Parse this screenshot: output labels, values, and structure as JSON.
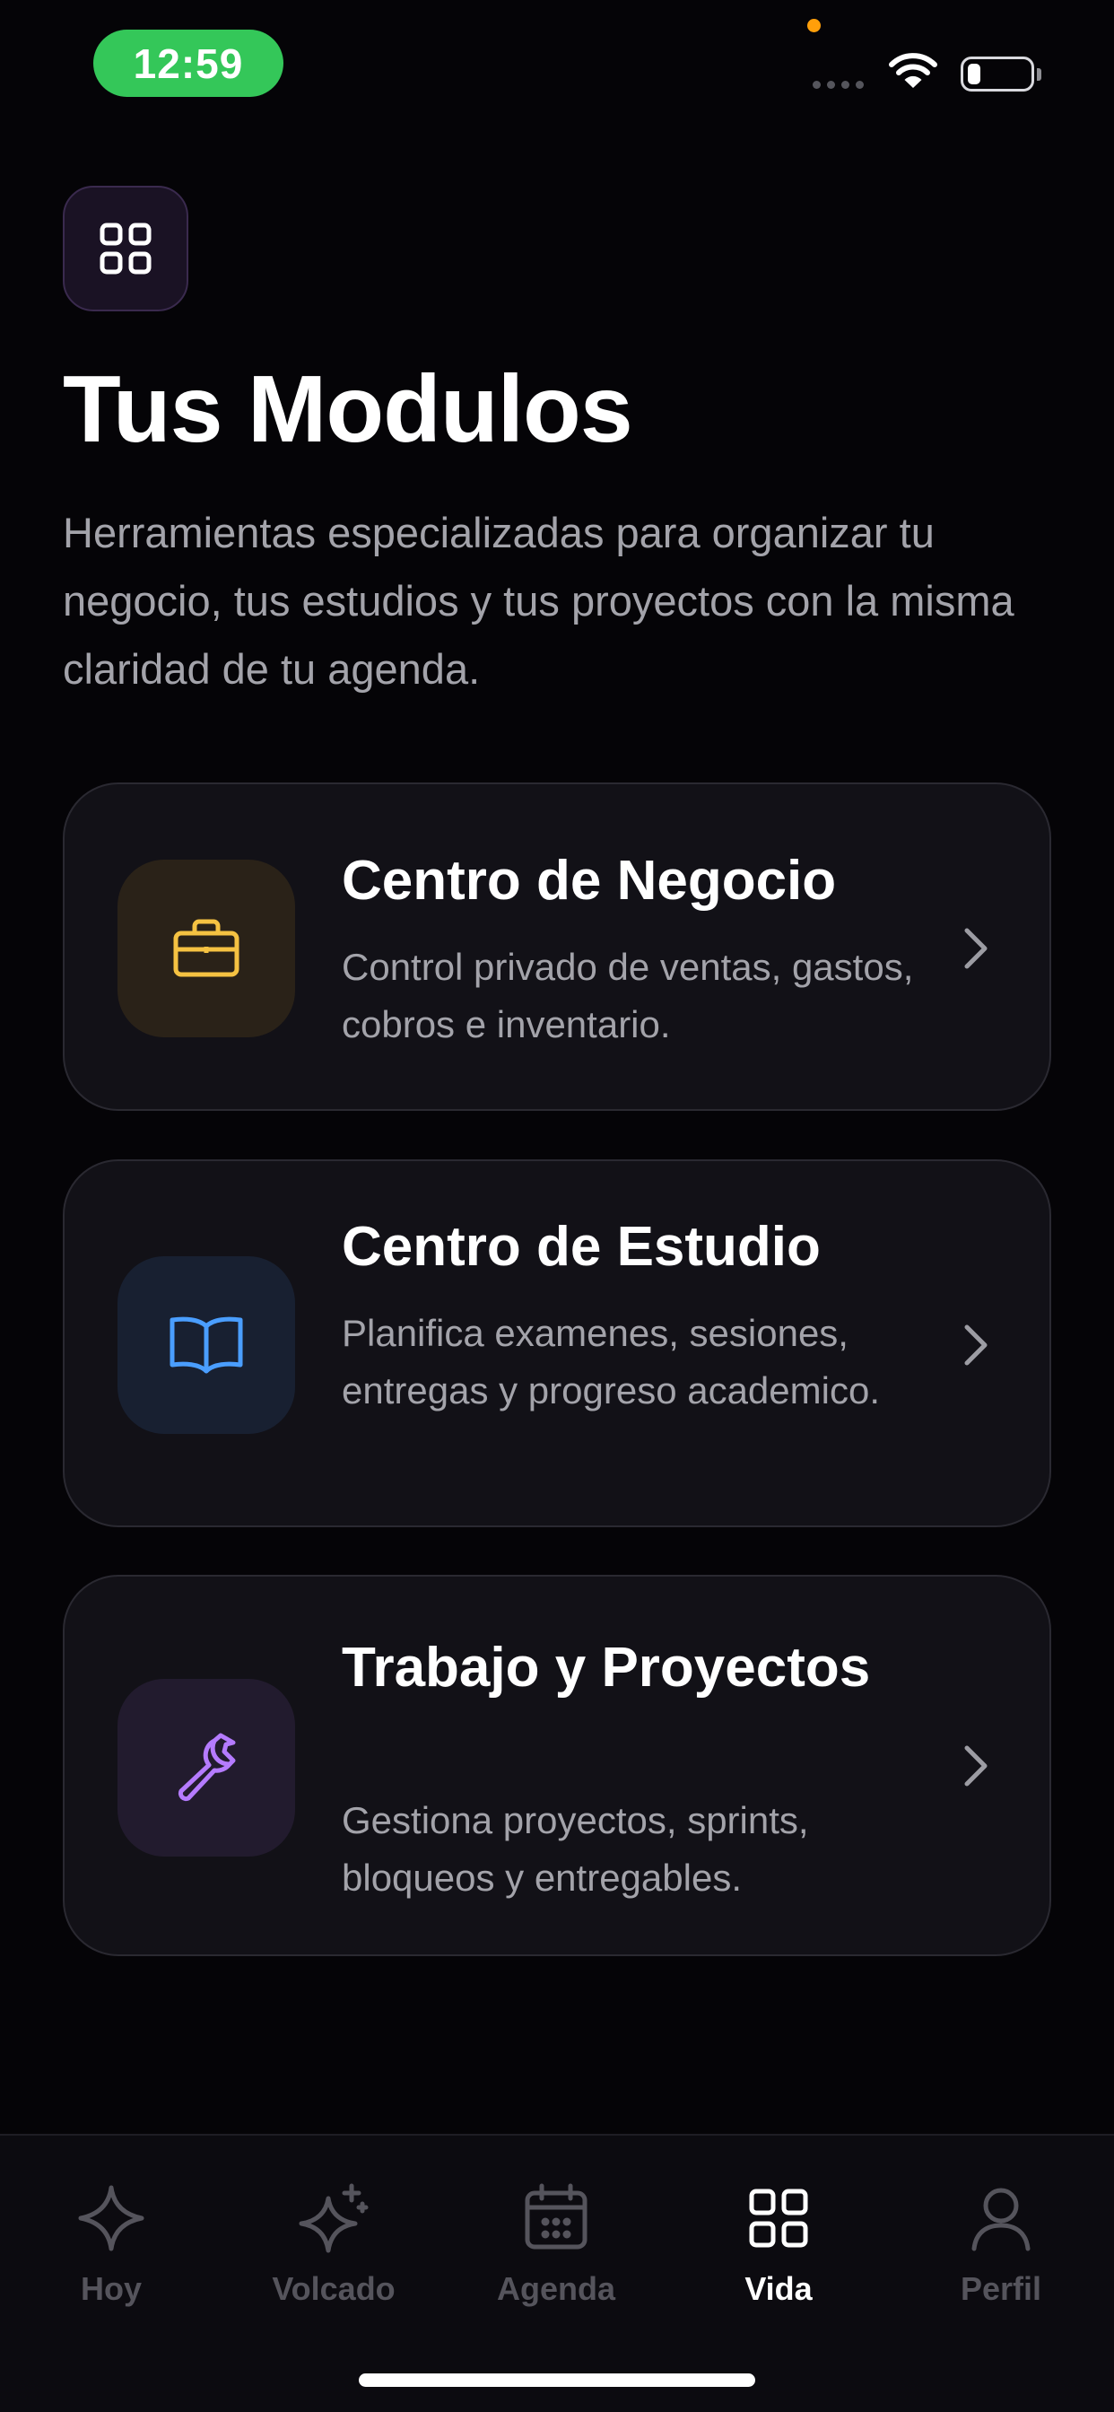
{
  "status_bar": {
    "time": "12:59",
    "colors": {
      "time_pill": "#34c759",
      "privacy_dot": "#ff9f0a"
    }
  },
  "header": {
    "icon": "grid-icon",
    "title": "Tus Modulos",
    "description": "Herramientas especializadas para organizar tu negocio, tus estudios y tus proyectos con la misma claridad de tu agenda."
  },
  "modules": [
    {
      "title": "Centro de Negocio",
      "description": "Control privado de ventas, gastos, cobros e inventario.",
      "icon": "briefcase-icon",
      "accent": "#f5c242"
    },
    {
      "title": "Centro de Estudio",
      "description": "Planifica examenes, sesiones, entregas y progreso academico.",
      "icon": "book-icon",
      "accent": "#4a9eff"
    },
    {
      "title": "Trabajo y Proyectos",
      "description": "Gestiona proyectos, sprints, bloqueos y entregables.",
      "icon": "wrench-icon",
      "accent": "#b57bff"
    }
  ],
  "tabbar": {
    "active": "Vida",
    "tabs": [
      {
        "label": "Hoy",
        "icon": "sparkle-icon"
      },
      {
        "label": "Volcado",
        "icon": "sparkles-plus-icon"
      },
      {
        "label": "Agenda",
        "icon": "calendar-icon"
      },
      {
        "label": "Vida",
        "icon": "grid-icon"
      },
      {
        "label": "Perfil",
        "icon": "person-icon"
      }
    ]
  }
}
